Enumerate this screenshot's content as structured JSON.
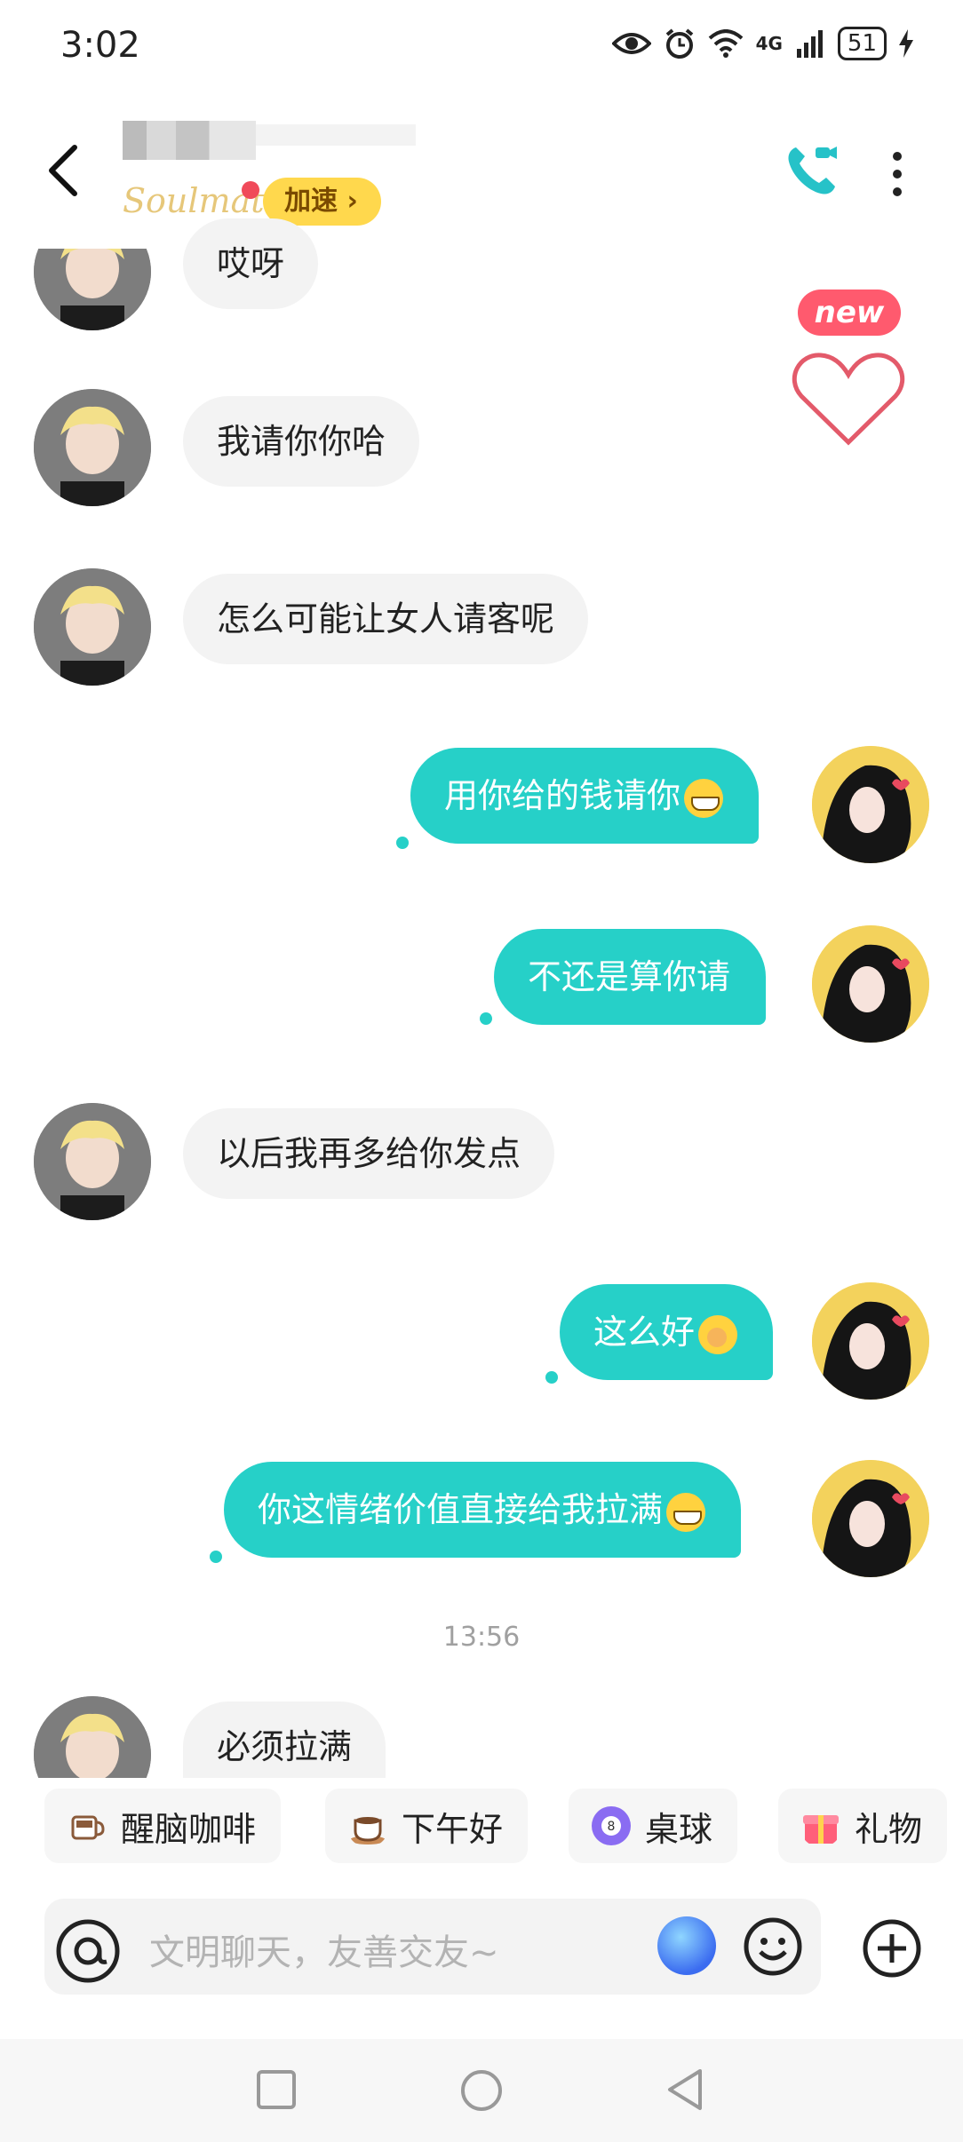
{
  "status_bar": {
    "time": "3:02",
    "battery": "51",
    "signal_tag": "4G"
  },
  "header": {
    "badge_label": "Soulmate",
    "speed_button": "加速 ›"
  },
  "side_widget": {
    "new_label": "new"
  },
  "messages": [
    {
      "side": "left",
      "text": "哎呀"
    },
    {
      "side": "left",
      "text": "我请你你哈"
    },
    {
      "side": "left",
      "text": "怎么可能让女人请客呢"
    },
    {
      "side": "right",
      "text": "用你给的钱请你",
      "emoji": "grin"
    },
    {
      "side": "right",
      "text": "不还是算你请"
    },
    {
      "side": "left",
      "text": "以后我再多给你发点"
    },
    {
      "side": "right",
      "text": "这么好",
      "emoji": "blush"
    },
    {
      "side": "right",
      "text": "你这情绪价值直接给我拉满",
      "emoji": "grin"
    },
    {
      "side": "left",
      "text": "必须拉满"
    }
  ],
  "timestamp": "13:56",
  "quick_chips": [
    {
      "label": "醒脑咖啡",
      "icon": "coffee-icon"
    },
    {
      "label": "下午好",
      "icon": "tea-cup-icon"
    },
    {
      "label": "桌球",
      "icon": "billiard-ball-icon"
    },
    {
      "label": "礼物",
      "icon": "gift-icon"
    }
  ],
  "input": {
    "placeholder": "文明聊天，友善交友~"
  },
  "colors": {
    "accent": "#26d0c8",
    "badge": "#ffd84d",
    "new": "#ff5a6e"
  }
}
